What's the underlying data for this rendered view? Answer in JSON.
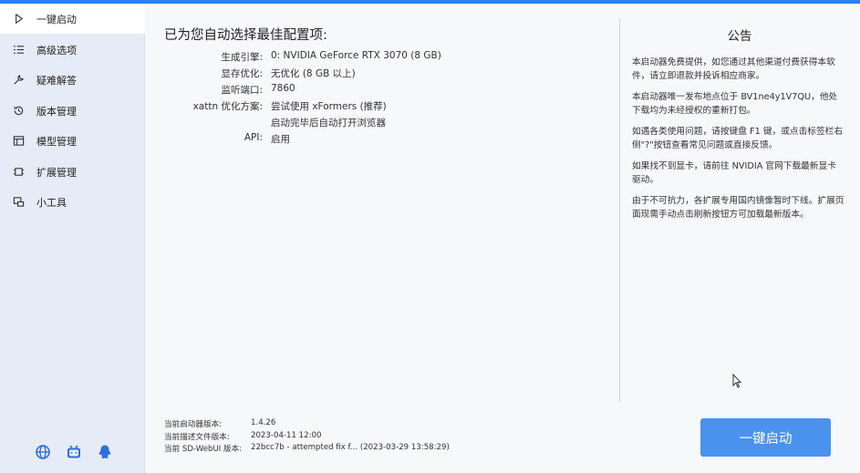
{
  "sidebar": {
    "items": [
      {
        "label": "一键启动",
        "icon": "play-icon",
        "active": true
      },
      {
        "label": "高级选项",
        "icon": "list-icon",
        "active": false
      },
      {
        "label": "疑难解答",
        "icon": "wrench-icon",
        "active": false
      },
      {
        "label": "版本管理",
        "icon": "history-icon",
        "active": false
      },
      {
        "label": "模型管理",
        "icon": "window-icon",
        "active": false
      },
      {
        "label": "扩展管理",
        "icon": "chip-icon",
        "active": false
      },
      {
        "label": "小工具",
        "icon": "tools-icon",
        "active": false
      }
    ],
    "bottom_icons": [
      "globe-icon",
      "bilibili-icon",
      "qq-icon"
    ]
  },
  "main": {
    "title": "已为您自动选择最佳配置项:",
    "config": [
      {
        "label": "生成引擎:",
        "value": "0: NVIDIA GeForce RTX 3070 (8 GB)"
      },
      {
        "label": "显存优化:",
        "value": "无优化 (8 GB 以上)"
      },
      {
        "label": "监听端口:",
        "value": "7860"
      },
      {
        "label": "xattn 优化方案:",
        "value": "尝试使用 xFormers (推荐)"
      },
      {
        "label": "",
        "value": "启动完毕后自动打开浏览器"
      },
      {
        "label": "API:",
        "value": "启用"
      }
    ],
    "versions": [
      {
        "label": "当前启动器版本:",
        "value": "1.4.26"
      },
      {
        "label": "当前描述文件版本:",
        "value": "2023-04-11 12:00"
      },
      {
        "label": "当前 SD-WebUI 版本:",
        "value": "22bcc7b - attempted fix f... (2023-03-29 13:58:29)"
      }
    ],
    "launch_label": "一键启动"
  },
  "notice": {
    "title": "公告",
    "paragraphs": [
      "本启动器免费提供，如您通过其他渠道付费获得本软件，请立即退款并投诉相应商家。",
      "本启动器唯一发布地点位于 BV1ne4y1V7QU，他处下载均为未经授权的重新打包。",
      "如遇各类使用问题，请按键盘 F1 键，或点击标签栏右侧\"?\"按钮查看常见问题或直接反馈。",
      "如果找不到显卡，请前往 NVIDIA 官网下载最新显卡驱动。",
      "由于不可抗力，各扩展专用国内镜像暂时下线。扩展页面现需手动点击刷新按钮方可加载最新版本。"
    ]
  },
  "colors": {
    "accent": "#2f7cf6",
    "button": "#4a92ee",
    "sidebar_bg": "#e6ecf7"
  }
}
